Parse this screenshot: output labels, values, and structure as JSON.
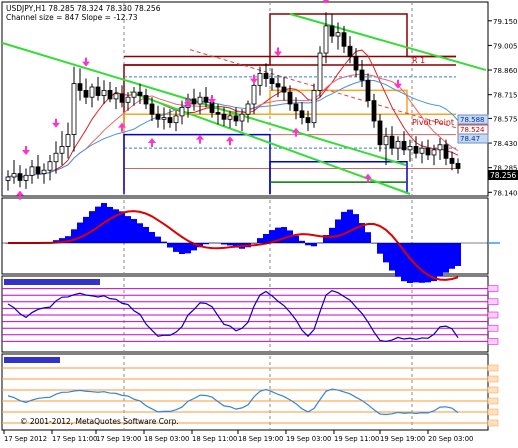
{
  "header": {
    "line1": "USDJPY,H1  78.285 78.324 78.330 78.256",
    "line2": "Channel size = 847 Slope = -12.73"
  },
  "copyright": "© 2001-2012, MetaQuotes Software Corp.",
  "colors": {
    "background": "#ffffff",
    "bull_candle": "#ffffff",
    "bear_candle": "#000000",
    "channel_green": "#33dd33",
    "resistance_dark_red": "#8b0000",
    "pivot_orange": "#f5a623",
    "channel_blue": "#0000cc",
    "histogram_blue": "#0000ff",
    "macd_signal_red": "#dd0000",
    "stoch_purple": "#cc00cc",
    "stoch_line": "#0000cc",
    "bottom_orange": "#ff9933",
    "bottom_line": "#2e86de",
    "price_tag_dark": "#000000",
    "price_tag_blue": "#c6d9f1",
    "fractal_arrow": "#ff33cc"
  },
  "price_axis": {
    "labels": [
      "79.150",
      "79.005",
      "78.860",
      "78.715",
      "78.575",
      "78.430",
      "78.285",
      "78.140"
    ],
    "current_price": "78.256",
    "tag_blue_1": "78.588",
    "tag_red": "78.524",
    "tag_blue_2": "78.47"
  },
  "chart_annotations": {
    "r1_label": "R 1",
    "pivot_label": "Pivot Point"
  },
  "time_axis": {
    "labels": [
      "17 Sep 2012",
      "17 Sep 11:00",
      "17 Sep 19:00",
      "18 Sep 03:00",
      "18 Sep 11:00",
      "18 Sep 19:00",
      "19 Sep 03:00",
      "19 Sep 11:00",
      "19 Sep 19:00",
      "20 Sep 03:00"
    ]
  },
  "candles": [
    {
      "o": 78.21,
      "h": 78.27,
      "l": 78.15,
      "c": 78.23
    },
    {
      "o": 78.23,
      "h": 78.33,
      "l": 78.19,
      "c": 78.25
    },
    {
      "o": 78.25,
      "h": 78.3,
      "l": 78.17,
      "c": 78.21
    },
    {
      "o": 78.21,
      "h": 78.28,
      "l": 78.16,
      "c": 78.24
    },
    {
      "o": 78.24,
      "h": 78.33,
      "l": 78.19,
      "c": 78.29
    },
    {
      "o": 78.29,
      "h": 78.36,
      "l": 78.22,
      "c": 78.25
    },
    {
      "o": 78.25,
      "h": 78.31,
      "l": 78.19,
      "c": 78.27
    },
    {
      "o": 78.27,
      "h": 78.36,
      "l": 78.21,
      "c": 78.32
    },
    {
      "o": 78.32,
      "h": 78.44,
      "l": 78.25,
      "c": 78.37
    },
    {
      "o": 78.37,
      "h": 78.5,
      "l": 78.3,
      "c": 78.41
    },
    {
      "o": 78.41,
      "h": 78.55,
      "l": 78.34,
      "c": 78.48
    },
    {
      "o": 78.48,
      "h": 78.88,
      "l": 78.38,
      "c": 78.78
    },
    {
      "o": 78.78,
      "h": 78.87,
      "l": 78.68,
      "c": 78.74
    },
    {
      "o": 78.74,
      "h": 78.81,
      "l": 78.66,
      "c": 78.7
    },
    {
      "o": 78.7,
      "h": 78.78,
      "l": 78.64,
      "c": 78.76
    },
    {
      "o": 78.76,
      "h": 78.82,
      "l": 78.68,
      "c": 78.71
    },
    {
      "o": 78.71,
      "h": 78.8,
      "l": 78.66,
      "c": 78.74
    },
    {
      "o": 78.74,
      "h": 78.79,
      "l": 78.67,
      "c": 78.69
    },
    {
      "o": 78.69,
      "h": 78.76,
      "l": 78.63,
      "c": 78.72
    },
    {
      "o": 78.72,
      "h": 78.77,
      "l": 78.64,
      "c": 78.67
    },
    {
      "o": 78.67,
      "h": 78.73,
      "l": 78.62,
      "c": 78.7
    },
    {
      "o": 78.7,
      "h": 78.76,
      "l": 78.65,
      "c": 78.73
    },
    {
      "o": 78.73,
      "h": 78.78,
      "l": 78.66,
      "c": 78.71
    },
    {
      "o": 78.71,
      "h": 78.75,
      "l": 78.63,
      "c": 78.66
    },
    {
      "o": 78.66,
      "h": 78.7,
      "l": 78.56,
      "c": 78.6
    },
    {
      "o": 78.6,
      "h": 78.65,
      "l": 78.52,
      "c": 78.57
    },
    {
      "o": 78.57,
      "h": 78.64,
      "l": 78.51,
      "c": 78.58
    },
    {
      "o": 78.58,
      "h": 78.63,
      "l": 78.52,
      "c": 78.55
    },
    {
      "o": 78.55,
      "h": 78.62,
      "l": 78.5,
      "c": 78.59
    },
    {
      "o": 78.59,
      "h": 78.68,
      "l": 78.54,
      "c": 78.64
    },
    {
      "o": 78.64,
      "h": 78.72,
      "l": 78.58,
      "c": 78.69
    },
    {
      "o": 78.69,
      "h": 78.75,
      "l": 78.62,
      "c": 78.66
    },
    {
      "o": 78.66,
      "h": 78.73,
      "l": 78.6,
      "c": 78.7
    },
    {
      "o": 78.7,
      "h": 78.76,
      "l": 78.64,
      "c": 78.67
    },
    {
      "o": 78.67,
      "h": 78.71,
      "l": 78.58,
      "c": 78.61
    },
    {
      "o": 78.61,
      "h": 78.66,
      "l": 78.54,
      "c": 78.6
    },
    {
      "o": 78.6,
      "h": 78.64,
      "l": 78.53,
      "c": 78.57
    },
    {
      "o": 78.57,
      "h": 78.62,
      "l": 78.52,
      "c": 78.59
    },
    {
      "o": 78.59,
      "h": 78.64,
      "l": 78.53,
      "c": 78.56
    },
    {
      "o": 78.56,
      "h": 78.63,
      "l": 78.5,
      "c": 78.6
    },
    {
      "o": 78.6,
      "h": 78.68,
      "l": 78.55,
      "c": 78.66
    },
    {
      "o": 78.66,
      "h": 78.8,
      "l": 78.6,
      "c": 78.77
    },
    {
      "o": 78.77,
      "h": 78.88,
      "l": 78.71,
      "c": 78.84
    },
    {
      "o": 78.84,
      "h": 78.9,
      "l": 78.76,
      "c": 78.81
    },
    {
      "o": 78.81,
      "h": 78.87,
      "l": 78.74,
      "c": 78.78
    },
    {
      "o": 78.78,
      "h": 78.83,
      "l": 78.7,
      "c": 78.76
    },
    {
      "o": 78.76,
      "h": 78.82,
      "l": 78.68,
      "c": 78.73
    },
    {
      "o": 78.73,
      "h": 78.77,
      "l": 78.62,
      "c": 78.66
    },
    {
      "o": 78.66,
      "h": 78.7,
      "l": 78.57,
      "c": 78.62
    },
    {
      "o": 78.62,
      "h": 78.67,
      "l": 78.54,
      "c": 78.58
    },
    {
      "o": 78.58,
      "h": 78.62,
      "l": 78.5,
      "c": 78.55
    },
    {
      "o": 78.55,
      "h": 78.78,
      "l": 78.52,
      "c": 78.74
    },
    {
      "o": 78.74,
      "h": 79.0,
      "l": 78.7,
      "c": 78.96
    },
    {
      "o": 78.96,
      "h": 79.2,
      "l": 78.9,
      "c": 79.12
    },
    {
      "o": 79.12,
      "h": 79.19,
      "l": 79.02,
      "c": 79.06
    },
    {
      "o": 79.06,
      "h": 79.14,
      "l": 78.98,
      "c": 79.08
    },
    {
      "o": 79.08,
      "h": 79.12,
      "l": 78.96,
      "c": 79.0
    },
    {
      "o": 79.0,
      "h": 79.06,
      "l": 78.9,
      "c": 78.94
    },
    {
      "o": 78.94,
      "h": 78.99,
      "l": 78.82,
      "c": 78.86
    },
    {
      "o": 78.86,
      "h": 78.92,
      "l": 78.76,
      "c": 78.8
    },
    {
      "o": 78.8,
      "h": 78.84,
      "l": 78.64,
      "c": 78.68
    },
    {
      "o": 78.68,
      "h": 78.72,
      "l": 78.52,
      "c": 78.56
    },
    {
      "o": 78.56,
      "h": 78.6,
      "l": 78.38,
      "c": 78.42
    },
    {
      "o": 78.42,
      "h": 78.52,
      "l": 78.3,
      "c": 78.47
    },
    {
      "o": 78.47,
      "h": 78.53,
      "l": 78.36,
      "c": 78.4
    },
    {
      "o": 78.4,
      "h": 78.47,
      "l": 78.33,
      "c": 78.44
    },
    {
      "o": 78.44,
      "h": 78.5,
      "l": 78.36,
      "c": 78.39
    },
    {
      "o": 78.39,
      "h": 78.45,
      "l": 78.32,
      "c": 78.41
    },
    {
      "o": 78.41,
      "h": 78.47,
      "l": 78.34,
      "c": 78.37
    },
    {
      "o": 78.37,
      "h": 78.44,
      "l": 78.31,
      "c": 78.4
    },
    {
      "o": 78.4,
      "h": 78.45,
      "l": 78.33,
      "c": 78.36
    },
    {
      "o": 78.36,
      "h": 78.42,
      "l": 78.3,
      "c": 78.39
    },
    {
      "o": 78.39,
      "h": 78.46,
      "l": 78.33,
      "c": 78.42
    },
    {
      "o": 78.42,
      "h": 78.45,
      "l": 78.3,
      "c": 78.34
    },
    {
      "o": 78.34,
      "h": 78.38,
      "l": 78.27,
      "c": 78.31
    },
    {
      "o": 78.31,
      "h": 78.34,
      "l": 78.25,
      "c": 78.28
    }
  ],
  "fractals_up": [
    {
      "i": 3,
      "p": 78.36
    },
    {
      "i": 8,
      "p": 78.52
    },
    {
      "i": 13,
      "p": 78.88
    },
    {
      "i": 30,
      "p": 78.64
    },
    {
      "i": 34,
      "p": 78.66
    },
    {
      "i": 41,
      "p": 78.78
    },
    {
      "i": 45,
      "p": 78.94
    },
    {
      "i": 53,
      "p": 79.25
    },
    {
      "i": 65,
      "p": 78.75
    }
  ],
  "fractals_down": [
    {
      "i": 2,
      "p": 78.15
    },
    {
      "i": 19,
      "p": 78.55
    },
    {
      "i": 24,
      "p": 78.46
    },
    {
      "i": 32,
      "p": 78.48
    },
    {
      "i": 37,
      "p": 78.47
    },
    {
      "i": 48,
      "p": 78.52
    },
    {
      "i": 60,
      "p": 78.25
    }
  ]
}
